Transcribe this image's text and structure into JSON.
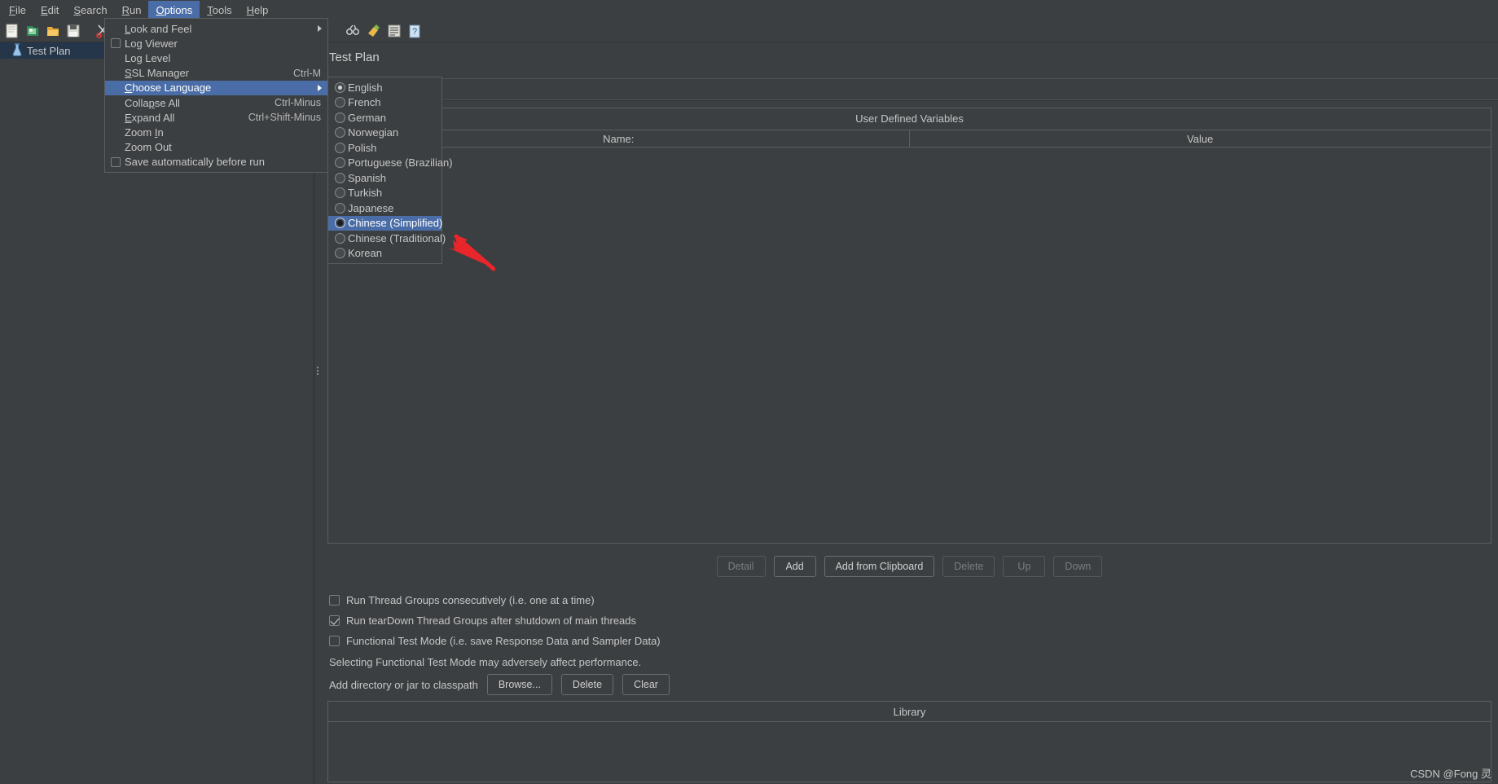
{
  "menubar": [
    {
      "label": "File",
      "mnemonic": "F",
      "active": false
    },
    {
      "label": "Edit",
      "mnemonic": "E",
      "active": false
    },
    {
      "label": "Search",
      "mnemonic": "S",
      "active": false
    },
    {
      "label": "Run",
      "mnemonic": "R",
      "active": false
    },
    {
      "label": "Options",
      "mnemonic": "O",
      "active": true
    },
    {
      "label": "Tools",
      "mnemonic": "T",
      "active": false
    },
    {
      "label": "Help",
      "mnemonic": "H",
      "active": false
    }
  ],
  "toolbar": {
    "icons": [
      "new-icon",
      "templates-icon",
      "open-icon",
      "save-icon",
      "cut-icon",
      "copy-icon",
      "paste-icon",
      "expand-icon",
      "help-icon"
    ]
  },
  "tree": {
    "nodes": [
      {
        "label": "Test Plan",
        "icon": "test-plan-icon",
        "selected": true
      }
    ]
  },
  "options_menu": {
    "items": [
      {
        "label": "Look and Feel",
        "pre": "L",
        "post": "ook and Feel",
        "accel": "",
        "submenu": true,
        "checkbox": false,
        "selected": false
      },
      {
        "label": "Log Viewer",
        "pre": "",
        "post": "Log Viewer",
        "accel": "",
        "submenu": false,
        "checkbox": true,
        "selected": false
      },
      {
        "label": "Log Level",
        "pre": "",
        "post": "Log Level",
        "accel": "",
        "submenu": false,
        "checkbox": false,
        "selected": false
      },
      {
        "label": "SSL Manager",
        "pre": "S",
        "post": "SL Manager",
        "accel": "Ctrl-M",
        "submenu": false,
        "checkbox": false,
        "selected": false
      },
      {
        "label": "Choose Language",
        "pre": "C",
        "post": "hoose Language",
        "accel": "",
        "submenu": true,
        "checkbox": false,
        "selected": true
      },
      {
        "label": "Collapse All",
        "pre": "Colla",
        "post": "pse All",
        "mid": "p",
        "accel": "Ctrl-Minus",
        "submenu": false,
        "checkbox": false,
        "selected": false
      },
      {
        "label": "Expand All",
        "pre": "E",
        "post": "xpand All",
        "accel": "Ctrl+Shift-Minus",
        "submenu": false,
        "checkbox": false,
        "selected": false
      },
      {
        "label": "Zoom In",
        "pre": "Zoom ",
        "post": "n",
        "mid": "I",
        "accel": "",
        "submenu": false,
        "checkbox": false,
        "selected": false
      },
      {
        "label": "Zoom Out",
        "pre": "",
        "post": "Zoom Out",
        "accel": "",
        "submenu": false,
        "checkbox": false,
        "selected": false
      },
      {
        "label": "Save automatically before run",
        "pre": "",
        "post": "Save automatically before run",
        "accel": "",
        "submenu": false,
        "checkbox": true,
        "selected": false
      }
    ]
  },
  "language_menu": {
    "items": [
      {
        "label": "English",
        "selected_radio": true,
        "highlighted": false
      },
      {
        "label": "French",
        "selected_radio": false,
        "highlighted": false
      },
      {
        "label": "German",
        "selected_radio": false,
        "highlighted": false
      },
      {
        "label": "Norwegian",
        "selected_radio": false,
        "highlighted": false
      },
      {
        "label": "Polish",
        "selected_radio": false,
        "highlighted": false
      },
      {
        "label": "Portuguese (Brazilian)",
        "selected_radio": false,
        "highlighted": false
      },
      {
        "label": "Spanish",
        "selected_radio": false,
        "highlighted": false
      },
      {
        "label": "Turkish",
        "selected_radio": false,
        "highlighted": false
      },
      {
        "label": "Japanese",
        "selected_radio": false,
        "highlighted": false
      },
      {
        "label": "Chinese (Simplified)",
        "selected_radio": true,
        "highlighted": true
      },
      {
        "label": "Chinese (Traditional)",
        "selected_radio": false,
        "highlighted": false
      },
      {
        "label": "Korean",
        "selected_radio": false,
        "highlighted": false
      }
    ]
  },
  "main": {
    "title": "Test Plan",
    "udv": {
      "title": "User Defined Variables",
      "columns": [
        "Name:",
        "Value"
      ],
      "rows": []
    },
    "buttons": [
      {
        "label": "Detail",
        "disabled": true
      },
      {
        "label": "Add",
        "disabled": false
      },
      {
        "label": "Add from Clipboard",
        "disabled": false
      },
      {
        "label": "Delete",
        "disabled": true
      },
      {
        "label": "Up",
        "disabled": true
      },
      {
        "label": "Down",
        "disabled": true
      }
    ],
    "checkboxes": [
      {
        "label": "Run Thread Groups consecutively (i.e. one at a time)",
        "checked": false
      },
      {
        "label": "Run tearDown Thread Groups after shutdown of main threads",
        "checked": true
      },
      {
        "label": "Functional Test Mode (i.e. save Response Data and Sampler Data)",
        "checked": false
      }
    ],
    "note": "Selecting Functional Test Mode may adversely affect performance.",
    "classpath": {
      "label": "Add directory or jar to classpath",
      "buttons": [
        "Browse...",
        "Delete",
        "Clear"
      ]
    },
    "library": {
      "title": "Library"
    }
  },
  "watermark": "CSDN @Fong 灵",
  "colors": {
    "accent": "#4a6da7",
    "background": "#3c3f41",
    "tree_selected": "#26364a",
    "arrow_annotation": "#e8262b"
  }
}
